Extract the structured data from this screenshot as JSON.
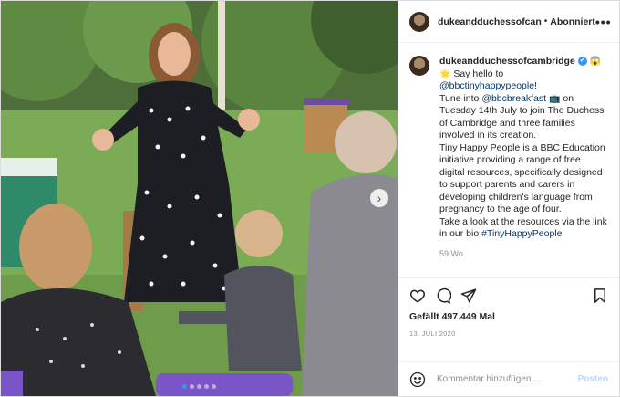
{
  "header": {
    "username": "dukeandduchessofcan",
    "separator": "•",
    "follow_status": "Abonniert",
    "more_icon": "more-horizontal-icon"
  },
  "caption": {
    "username": "dukeandduchessofcambridge",
    "verified_mark": "✔",
    "emoji_after_user": "😱",
    "line1_emoji": "🌟",
    "line1_text": "Say hello to",
    "line2_link": "@bbctinyhappypeople!",
    "p2_pre": "Tune into",
    "p2_link": "@bbcbreakfast",
    "p2_emoji": "📺",
    "p2_post": "on Tuesday 14th July to join The Duchess of Cambridge and three families involved in its creation.",
    "p3": "Tiny Happy People is a BBC Education initiative providing a range of free digital resources, specifically designed to support parents and carers in developing children's language from pregnancy to the age of four.",
    "p4_pre": "Take a look at the resources via the link in our bio",
    "p4_link": "#TinyHappyPeople",
    "age": "59 Wo."
  },
  "actions": {
    "icons": [
      "heart-icon",
      "comment-icon",
      "share-icon",
      "bookmark-icon"
    ],
    "likes": "Gefällt 497.449 Mal",
    "date": "13. JULI 2020"
  },
  "comment_box": {
    "emoji_icon": "emoji-smiley-icon",
    "placeholder": "Kommentar hinzufügen ...",
    "post_label": "Posten"
  },
  "carousel": {
    "slide_count": 5,
    "active_index": 0,
    "next_glyph": "›"
  },
  "colors": {
    "link": "#00376b",
    "verified": "#3897f0",
    "post_disabled": "#b3dbff",
    "muted": "#8e8e8e"
  }
}
